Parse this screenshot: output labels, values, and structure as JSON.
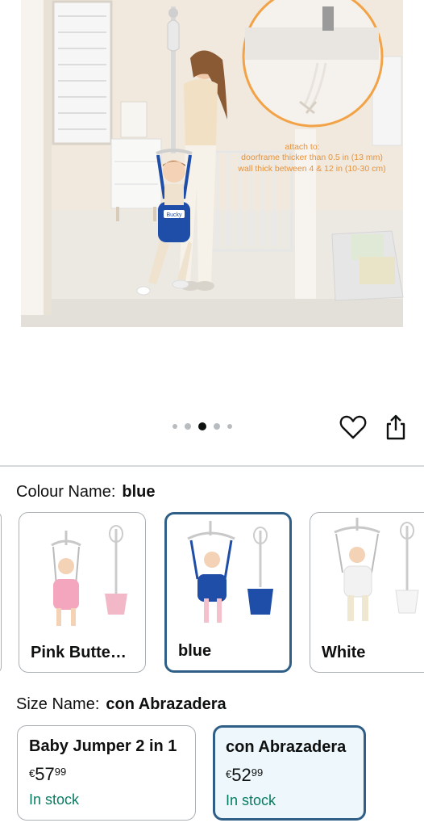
{
  "hero": {
    "callout_title": "attach to:",
    "callout_line1": "doorframe thicker than 0.5 in (13 mm)",
    "callout_line2": "wall thick between 4 & 12 in (10-30 cm)",
    "tag_text": "Bucky"
  },
  "carousel": {
    "total": 5,
    "active_index": 2
  },
  "actions": {
    "favorite_icon": "heart-icon",
    "share_icon": "share-icon"
  },
  "colour": {
    "label": "Colour Name:",
    "value": "blue",
    "options": [
      {
        "name": "Pink Butte…",
        "color": "#f3a6bd"
      },
      {
        "name": "blue",
        "color": "#1f4ea8",
        "selected": true
      },
      {
        "name": "White",
        "color": "#f2f2f2"
      }
    ]
  },
  "size": {
    "label": "Size Name:",
    "value": "con Abrazadera",
    "options": [
      {
        "name": "Baby Jumper 2 in 1",
        "currency": "€",
        "whole": "57",
        "cents": "99",
        "stock": "In stock"
      },
      {
        "name": "con Abrazadera",
        "currency": "€",
        "whole": "52",
        "cents": "99",
        "stock": "In stock",
        "selected": true
      }
    ]
  },
  "colors": {
    "accent": "#2f5f86",
    "stock": "#067d62",
    "callout": "#e8923a"
  }
}
